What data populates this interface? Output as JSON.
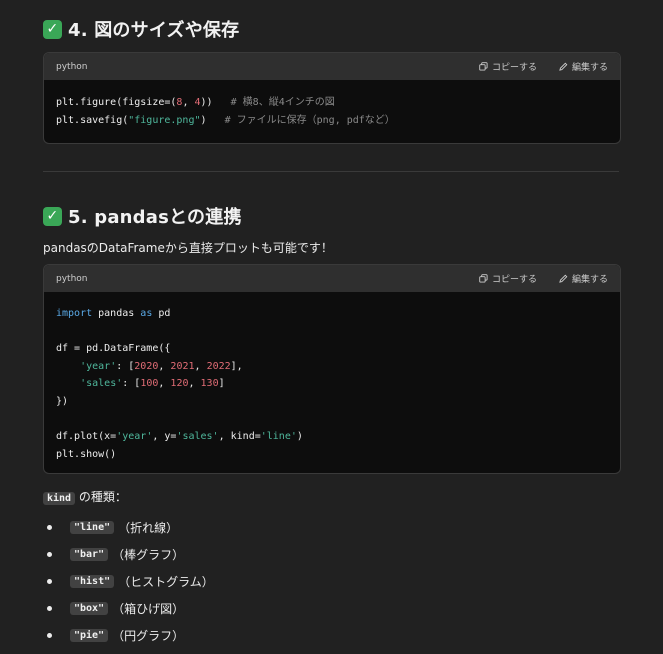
{
  "section4": {
    "number_title": "4. 図のサイズや保存"
  },
  "code1": {
    "lang": "python",
    "copy_label": "コピーする",
    "edit_label": "編集する",
    "lines": {
      "l1_a": "plt.figure(figsize=(",
      "l1_n1": "8",
      "l1_b": ", ",
      "l1_n2": "4",
      "l1_c": "))   ",
      "l1_cmt": "# 横8、縦4インチの図",
      "l2_a": "plt.savefig(",
      "l2_s": "\"figure.png\"",
      "l2_b": ")   ",
      "l2_cmt": "# ファイルに保存（png, pdfなど）"
    }
  },
  "section5": {
    "number_title": "5. pandasとの連携",
    "intro": "pandasのDataFrameから直接プロットも可能です！"
  },
  "code2": {
    "lang": "python",
    "copy_label": "コピーする",
    "edit_label": "編集する",
    "tok": {
      "import": "import",
      "pandas": " pandas ",
      "as": "as",
      "pd": " pd",
      "df_assign": "df = pd.DataFrame({",
      "year_key": "'year'",
      "colon": ": [",
      "y1": "2020",
      "y2": "2021",
      "y3": "2022",
      "comma": ", ",
      "close_list_comma": "],",
      "sales_key": "'sales'",
      "s1": "100",
      "s2": "120",
      "s3": "130",
      "close_list": "]",
      "close_obj": "})",
      "plot_a": "df.plot(x=",
      "plot_x": "'year'",
      "plot_b": ", y=",
      "plot_y": "'sales'",
      "plot_c": ", kind=",
      "plot_k": "'line'",
      "plot_d": ")",
      "show": "plt.show()"
    }
  },
  "kinds": {
    "code": "kind",
    "suffix": " の種類：",
    "items": [
      {
        "code": "\"line\"",
        "desc": "（折れ線）"
      },
      {
        "code": "\"bar\"",
        "desc": "（棒グラフ）"
      },
      {
        "code": "\"hist\"",
        "desc": "（ヒストグラム）"
      },
      {
        "code": "\"box\"",
        "desc": "（箱ひげ図）"
      },
      {
        "code": "\"pie\"",
        "desc": "（円グラフ）"
      }
    ]
  },
  "icons": {
    "check": "check-mark-icon",
    "copy": "copy-icon",
    "edit": "edit-pencil-icon"
  },
  "colors": {
    "check_bg": "#3aa757",
    "keyword": "#5aa9e6",
    "string": "#4fb79c",
    "number": "#e06c75",
    "comment": "#8a8a8a"
  }
}
